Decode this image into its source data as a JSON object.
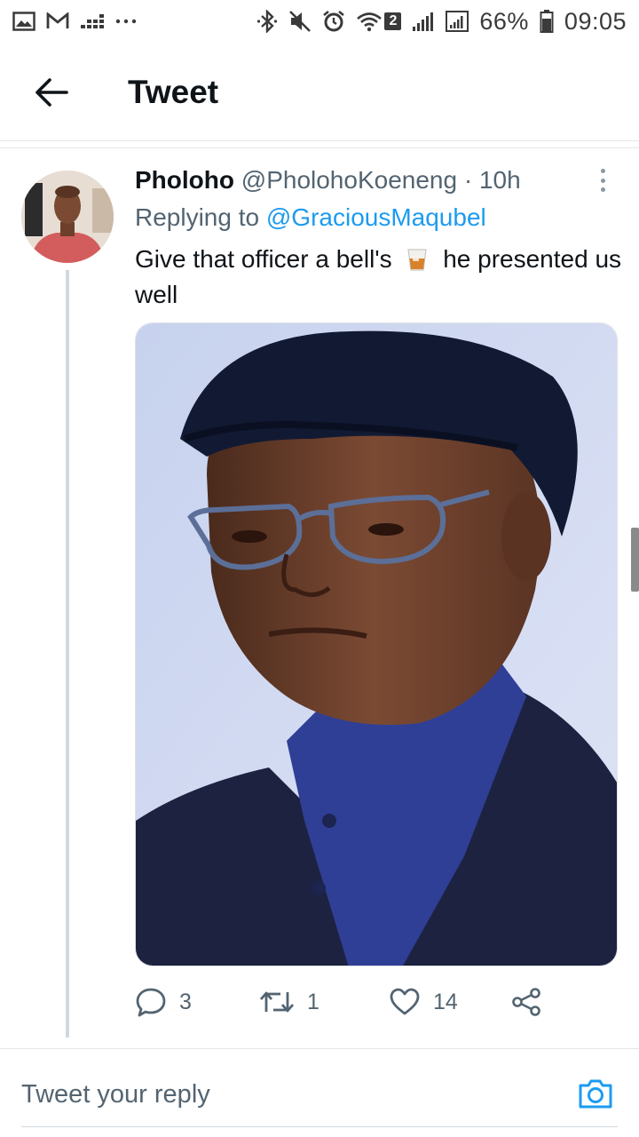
{
  "status_bar": {
    "left_icons": [
      "gallery-icon",
      "gmail-icon",
      "signal-meter-icon",
      "more-dots-icon"
    ],
    "right_icons": [
      "bluetooth-icon",
      "mute-icon",
      "alarm-icon",
      "wifi-icon",
      "sim-signal-icon",
      "sim2-signal-icon"
    ],
    "wifi_badge": "2",
    "battery": "66%",
    "time": "09:05"
  },
  "header": {
    "back_icon": "arrow-left-icon",
    "title": "Tweet"
  },
  "tweet": {
    "name": "Pholoho",
    "handle": "@PholohoKoeneng",
    "separator": "·",
    "time": "10h",
    "replying_prefix": "Replying to",
    "replying_to": "@GraciousMaqubel",
    "text_before_emoji": "Give that officer a bell's",
    "emoji": "tumbler-glass-icon",
    "text_after_emoji": "he presented us well",
    "media_icon": "photo-of-man-in-beret-and-glasses",
    "actions": {
      "reply_count": "3",
      "retweet_count": "1",
      "like_count": "14"
    }
  },
  "reply_bar": {
    "placeholder": "Tweet your reply",
    "camera_icon": "camera-icon"
  },
  "colors": {
    "accent": "#1d9bf0",
    "secondary_text": "#536471",
    "primary_text": "#0f1419"
  }
}
